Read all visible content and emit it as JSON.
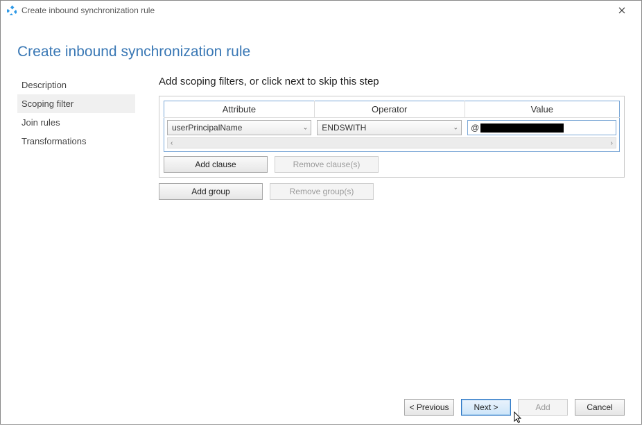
{
  "window": {
    "title": "Create inbound synchronization rule"
  },
  "page": {
    "title": "Create inbound synchronization rule"
  },
  "nav": {
    "items": [
      {
        "label": "Description",
        "active": false
      },
      {
        "label": "Scoping filter",
        "active": true
      },
      {
        "label": "Join rules",
        "active": false
      },
      {
        "label": "Transformations",
        "active": false
      }
    ]
  },
  "main": {
    "instruction": "Add scoping filters, or click next to skip this step",
    "columns": {
      "attribute": "Attribute",
      "operator": "Operator",
      "value": "Value"
    },
    "row": {
      "attribute": "userPrincipalName",
      "operator": "ENDSWITH",
      "value_prefix": "@",
      "value_redacted": true
    },
    "buttons": {
      "add_clause": "Add clause",
      "remove_clauses": "Remove clause(s)",
      "add_group": "Add group",
      "remove_groups": "Remove group(s)"
    }
  },
  "footer": {
    "previous": "< Previous",
    "next": "Next >",
    "add": "Add",
    "cancel": "Cancel"
  }
}
